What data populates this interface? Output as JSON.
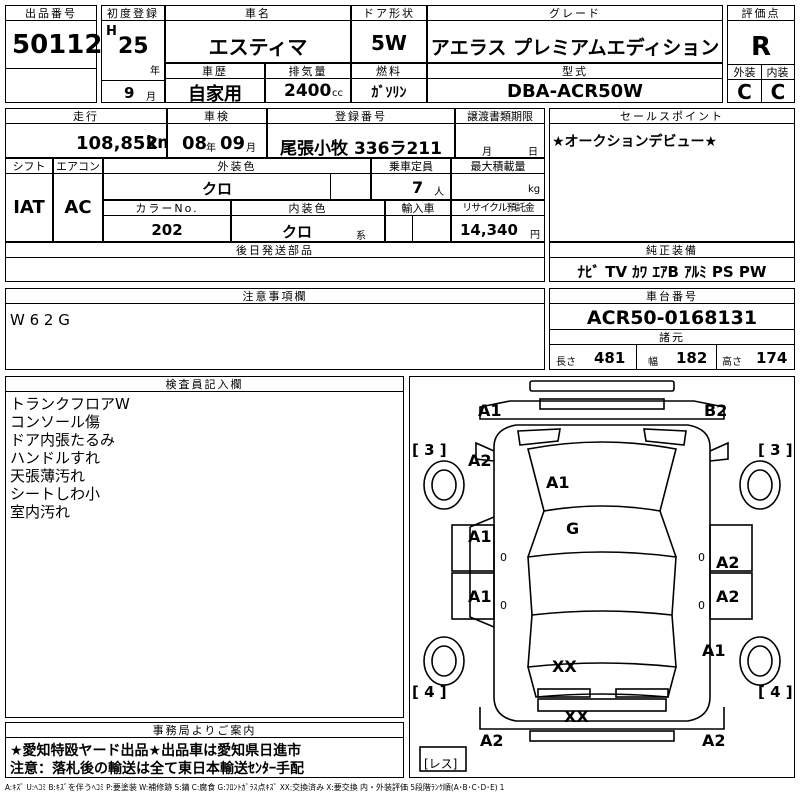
{
  "header": {
    "lot_label": "出品番号",
    "lot": "50112",
    "first_reg_label": "初度登録",
    "era": "H",
    "year": "25",
    "year_unit": "年",
    "month": "9",
    "month_unit": "月",
    "car_name_label": "車名",
    "car_name": "エスティマ",
    "door_label": "ドア形状",
    "door": "5W",
    "grade_label": "グレード",
    "grade": "アエラス プレミアムエディション",
    "score_label": "評価点",
    "score": "R",
    "history_label": "車歴",
    "history": "自家用",
    "displacement_label": "排気量",
    "displacement": "2400",
    "cc": "cc",
    "fuel_label": "燃料",
    "fuel": "ｶﾞｿﾘﾝ",
    "model_label": "型式",
    "model": "DBA-ACR50W",
    "ext_label": "外装",
    "ext": "C",
    "int_label": "内装",
    "int": "C"
  },
  "row2": {
    "mileage_label": "走行",
    "mileage": "108,852",
    "km": "km",
    "inspection_label": "車検",
    "insp_year": "08",
    "insp_year_unit": "年",
    "insp_month": "09",
    "insp_month_unit": "月",
    "plate_label": "登録番号",
    "plate": "尾張小牧 336ラ211",
    "transfer_label": "譲渡書類期限",
    "transfer_month": "月",
    "transfer_day": "日",
    "sales_label": "セールスポイント",
    "sales": "★オークションデビュー★",
    "shift_label": "シフト",
    "shift": "IAT",
    "ac_label": "エアコン",
    "ac": "AC",
    "ext_color_label": "外装色",
    "ext_color": "クロ",
    "capacity_label": "乗車定員",
    "capacity": "7",
    "capacity_unit": "人",
    "load_label": "最大積載量",
    "load_unit": "kg",
    "color_no_label": "カラーNo.",
    "color_no": "202",
    "int_color_label": "内装色",
    "int_color": "クロ",
    "int_color_unit": "系",
    "import_label": "輸入車",
    "recycle_label": "リサイクル預託金",
    "recycle": "14,340",
    "recycle_unit": "円",
    "later_label": "後日発送部品",
    "equip_label": "純正装備",
    "equip": "ﾅﾋﾞ TV ｶﾜ ｴｱB ｱﾙﾐ PS PW"
  },
  "notes": {
    "caution_label": "注意事項欄",
    "caution": "W 6 2 G",
    "chassis_label": "車台番号",
    "chassis": "ACR50-0168131",
    "spec_label": "諸元",
    "length_label": "長さ",
    "length": "481",
    "width_label": "幅",
    "width": "182",
    "height_label": "高さ",
    "height": "174"
  },
  "inspector": {
    "label": "検査員記入欄",
    "lines": [
      "トランクフロアW",
      "コンソール傷",
      "ドア内張たるみ",
      "ハンドルすれ",
      "天張薄汚れ",
      "シートしわ小",
      "室内汚れ"
    ]
  },
  "office": {
    "label": "事務局よりご案内",
    "line1": "★愛知特殴ヤード出品★出品車は愛知県日進市",
    "line2": "注意：落札後の輸送は全て東日本輸送ｾﾝﾀｰ手配"
  },
  "diagram": {
    "a1_fl": "A1",
    "b2_fr": "B2",
    "a2_l": "A2",
    "a1_hood": "A1",
    "g_glass": "G",
    "a1_ld1": "A1",
    "a1_ld2": "A1",
    "a2_rd1": "A2",
    "a2_rd2": "A2",
    "a1_r": "A1",
    "xx_roof": "XX",
    "xx_rear": "XX",
    "a2_rl": "A2",
    "a2_rr": "A2",
    "t3l": "[ 3 ]",
    "t3r": "[ 3 ]",
    "t4l": "[ 4 ]",
    "t4r": "[ 4 ]",
    "zero1": "0",
    "zero2": "0",
    "zero3": "0",
    "zero4": "0",
    "less": "[レス]"
  },
  "legend": "A:ｷｽﾞ U:ﾍｺﾐ B:ｷｽﾞを伴うﾍｺﾐ P:要塗装 W:補修跡 S:錆 C:腐食 G:ﾌﾛﾝﾄｶﾞﾗｽ点ｷｽﾞ XX:交換済み X:要交換 内・外装評価 5段階ﾗﾝｸ順(A･B･C･D･E) 1"
}
